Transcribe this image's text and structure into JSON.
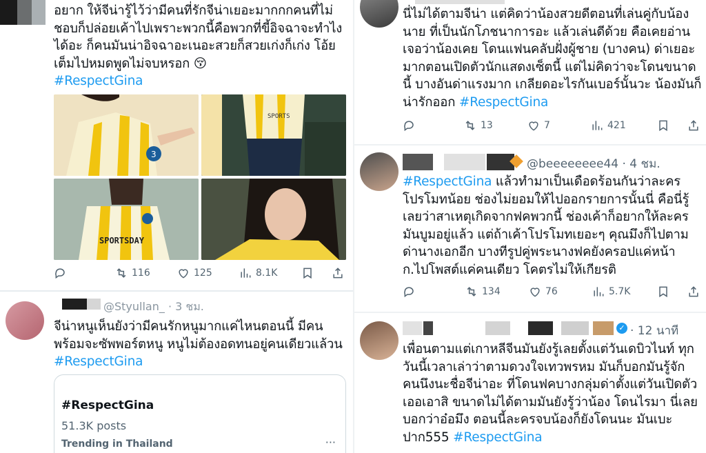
{
  "colors": {
    "link": "#1d9bf0",
    "muted": "#536471",
    "border": "#cfd9de",
    "verified": "#1d9bf0"
  },
  "top_left_post": {
    "lines": [
      "อยาก ให้จีน่ารู้ไว้ว่ามีคนที่รักจีน่าเยอะมากกกคนที่ไม่",
      "ชอบก็ปล่อยเค้าไปเพราะพวกนี้คือพวกที่ขี้อิจฉาจะทำไง",
      "ได้อะ ก็คนมันน่าอิจฉาอะเนอะสวยก็สวยเก่งก็เก่ง โอ้ย",
      "เต็มไปหมดพูดไม่จบหรอก 😚"
    ],
    "hashtag": "#RespectGina",
    "photos": [
      {
        "icon": "photo-pointing",
        "jersey_text": ""
      },
      {
        "icon": "photo-standing",
        "jersey_text": "SPORTS"
      },
      {
        "icon": "photo-sportsday",
        "jersey_text": "SPORTSDAY"
      },
      {
        "icon": "photo-smile",
        "jersey_text": ""
      }
    ],
    "stats": {
      "reposts": "116",
      "likes": "125",
      "views": "8.1K"
    }
  },
  "bottom_left_post": {
    "handle_fragment": "@Styullan_ · 3 ชม.",
    "lines": [
      "จีน่าหนูเห็นยังว่ามีคนรักหนูมากแค่ไหนตอนนี้ มีคน",
      "พร้อมจะซัพพอร์ตหนู หนูไม่ต้องอดทนอยู่คนเดียวแล้วน"
    ],
    "hashtag": "#RespectGina",
    "trend_card": {
      "title": "#RespectGina",
      "count": "51.3K posts",
      "label": "Trending in Thailand",
      "more": "···"
    }
  },
  "top_right_post": {
    "lines": [
      "นี่ไม่ได้ตามจีน่า แต่คิดว่าน้องสวยดีตอนที่เล่นคู่กับน้อง",
      "นาย ที่เป็นนักโภชนาการอะ แล้วเล่นดีด้วย คือเคยอ่าน",
      "เจอว่าน้องเคย โดนแฟนคลับฝั่งผู้ชาย (บางคน) ด่าเยอะ",
      "มากตอนเปิดตัวนักแสดงเซ็ตนี้ แต่ไม่คิดว่าจะโดนขนาด",
      "นี้ บางอันด่าแรงมาก เกลียดอะไรกันเบอร์นั้นวะ น้องมันก็"
    ],
    "last_line": "น่ารักออก",
    "hashtag": "#RespectGina",
    "stats": {
      "reposts": "13",
      "likes": "7",
      "views": "421"
    }
  },
  "middle_right_post": {
    "handle": "@beeeeeeee44 · 4 ชม.",
    "hashtag": "#RespectGina",
    "first_line_rest": "แล้วทำมาเป็นเดือดร้อนกันว่าละคร",
    "lines": [
      "โปรโมทน้อย ช่องไม่ยอมให้ไปออกรายการนั้นนี่ คือนี่รู้",
      "เลยว่าสาเหตุเกิดจากฟคพวกนี้ ช่องเค้าก็อยากให้ละคร",
      "มันบูมอยู่แล้ว แต่ถ้าเค้าโปรโมทเยอะๆ คุณมึงก็ไปตาม",
      "ด่านางเอกอีก บางทีรูปคู่พระนางฟคยังครอปแค่หน้า",
      "ก.ไปโพสต์แค่คนเดียว โคตรไม่ให้เกียรติ"
    ],
    "stats": {
      "reposts": "134",
      "likes": "76",
      "views": "5.7K"
    }
  },
  "bottom_right_post": {
    "time": "· 12 นาที",
    "lines": [
      "เพื่อนตามแต่เกาหลีจีนมันยังรู้เลยตั้งแต่วันเดบิวไนท์ ทุก",
      "วันนี้เวลาเล่าว่าตามดวงใจเทวพรหม มันก็บอกมันรู้จัก",
      "คนนึงนะชื่อจีน่าอะ ที่โดนฟคบางกลุ่มด่าตั้งแต่วันเปิดตัว",
      "เออเอาสิ ขนาดไม่ได้ตามมันยังรู้ว่าน้อง โดนไรมา นี่เลย",
      "บอกว่าอ๋อมึง ตอนนี้ละครจบน้องก็ยังโดนนะ มันเบะ"
    ],
    "last_line": "ปาก555",
    "hashtag": "#RespectGina"
  }
}
